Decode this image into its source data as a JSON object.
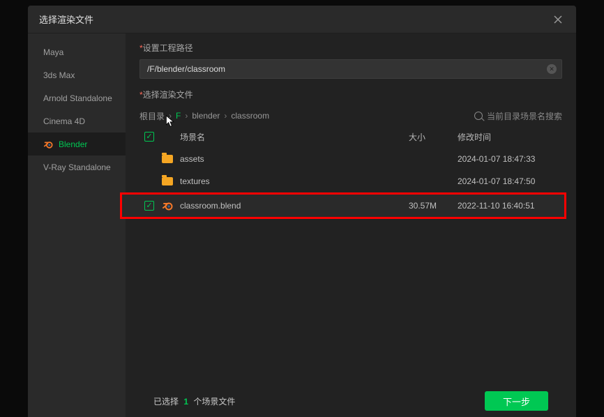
{
  "dialog": {
    "title": "选择渲染文件"
  },
  "sidebar": {
    "items": [
      {
        "label": "Maya"
      },
      {
        "label": "3ds Max"
      },
      {
        "label": "Arnold Standalone"
      },
      {
        "label": "Cinema 4D"
      },
      {
        "label": "Blender"
      },
      {
        "label": "V-Ray Standalone"
      }
    ]
  },
  "path": {
    "label": "设置工程路径",
    "value": "/F/blender/classroom"
  },
  "files": {
    "label": "选择渲染文件",
    "breadcrumb": [
      "根目录",
      "F",
      "blender",
      "classroom"
    ],
    "search_hint": "当前目录场景名搜索",
    "columns": {
      "name": "场景名",
      "size": "大小",
      "date": "修改时间"
    },
    "rows": [
      {
        "type": "folder",
        "name": "assets",
        "size": "",
        "date": "2024-01-07 18:47:33"
      },
      {
        "type": "folder",
        "name": "textures",
        "size": "",
        "date": "2024-01-07 18:47:50"
      },
      {
        "type": "blend",
        "name": "classroom.blend",
        "size": "30.57M",
        "date": "2022-11-10 16:40:51"
      }
    ]
  },
  "footer": {
    "selected_prefix": "已选择",
    "selected_count": "1",
    "selected_suffix": "个场景文件",
    "next": "下一步"
  }
}
